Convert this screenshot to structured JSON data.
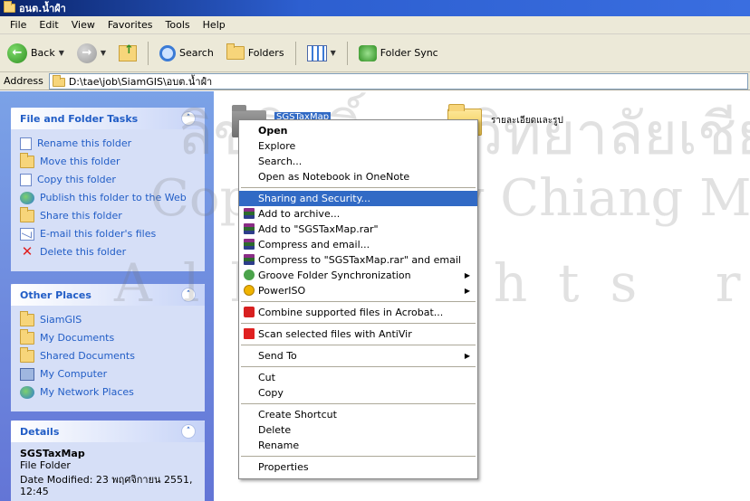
{
  "window": {
    "title": "อนต.น้ำฝำ"
  },
  "menubar": [
    "File",
    "Edit",
    "View",
    "Favorites",
    "Tools",
    "Help"
  ],
  "toolbar": {
    "back": "Back",
    "search": "Search",
    "folders": "Folders",
    "folder_sync": "Folder Sync"
  },
  "address": {
    "label": "Address",
    "path": "D:\\tae\\job\\SiamGIS\\อบต.น้ำฝำ"
  },
  "file_tasks": {
    "title": "File and Folder Tasks",
    "items": [
      {
        "label": "Rename this folder",
        "icon": "rename-icon"
      },
      {
        "label": "Move this folder",
        "icon": "move-icon"
      },
      {
        "label": "Copy this folder",
        "icon": "copy-icon"
      },
      {
        "label": "Publish this folder to the Web",
        "icon": "publish-icon"
      },
      {
        "label": "Share this folder",
        "icon": "share-icon"
      },
      {
        "label": "E-mail this folder's files",
        "icon": "email-icon"
      },
      {
        "label": "Delete this folder",
        "icon": "delete-icon"
      }
    ]
  },
  "other_places": {
    "title": "Other Places",
    "items": [
      {
        "label": "SiamGIS",
        "icon": "folder-icon"
      },
      {
        "label": "My Documents",
        "icon": "my-documents-icon"
      },
      {
        "label": "Shared Documents",
        "icon": "folder-icon"
      },
      {
        "label": "My Computer",
        "icon": "my-computer-icon"
      },
      {
        "label": "My Network Places",
        "icon": "network-icon"
      }
    ]
  },
  "details": {
    "title": "Details",
    "name": "SGSTaxMap",
    "type": "File Folder",
    "modified": "Date Modified: 23 พฤศจิกายน 2551, 12:45"
  },
  "files": [
    {
      "name": "SGSTaxMap",
      "selected": true
    },
    {
      "name": "รายละเอียดและรูป",
      "selected": false
    }
  ],
  "context_menu": {
    "open": "Open",
    "explore": "Explore",
    "search": "Search...",
    "onenote": "Open as Notebook in OneNote",
    "sharing": "Sharing and Security...",
    "add_archive": "Add to archive...",
    "add_rar": "Add to \"SGSTaxMap.rar\"",
    "compress_email": "Compress and email...",
    "compress_rar_email": "Compress to \"SGSTaxMap.rar\" and email",
    "groove": "Groove Folder Synchronization",
    "poweriso": "PowerISO",
    "acrobat": "Combine supported files in Acrobat...",
    "antivir": "Scan selected files with AntiVir",
    "send_to": "Send To",
    "cut": "Cut",
    "copy": "Copy",
    "create_shortcut": "Create Shortcut",
    "delete": "Delete",
    "rename": "Rename",
    "properties": "Properties"
  },
  "watermark": {
    "line1": "ลิขสิทธิ์มหาวิทยาลัยเชียงใหม่",
    "line2": "Copyright by Chiang Mai University",
    "line3": "All rights reserved"
  }
}
